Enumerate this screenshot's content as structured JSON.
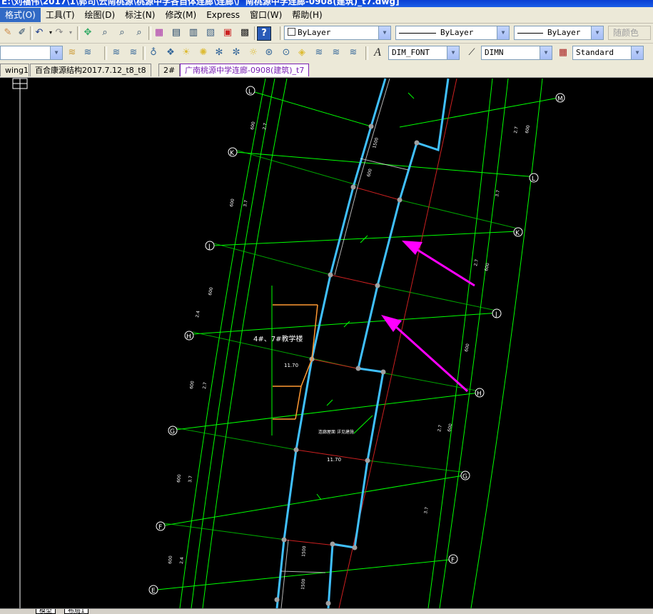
{
  "window": {
    "title": "E:\\刘福伟\\2017\\1\\郭司\\云南桃源\\桃源中学各自体连廊\\连廊\\广南桃源中学连廊-0908(建筑)_t7.dwg]"
  },
  "menu": [
    {
      "label": "格式(O)",
      "active": true
    },
    {
      "label": "工具(T)"
    },
    {
      "label": "绘图(D)"
    },
    {
      "label": "标注(N)"
    },
    {
      "label": "修改(M)"
    },
    {
      "label": "Express"
    },
    {
      "label": "窗口(W)"
    },
    {
      "label": "帮助(H)"
    }
  ],
  "toolbar1": {
    "color_combo": "ByLayer",
    "linetype_combo": "ByLayer",
    "lineweight_combo": "ByLayer",
    "plotstyle": "随颜色"
  },
  "toolbar2": {
    "text_style": "DIM_FONT",
    "dim_style": "DIMN",
    "table_style": "Standard"
  },
  "tabs": [
    {
      "label": "wing1"
    },
    {
      "label": "百合康源结构2017.7.12_t8_t8"
    },
    {
      "label": "2#"
    },
    {
      "label": "广南桃源中学连廊-0908(建筑)_t7",
      "active": true
    }
  ],
  "layout_tabs": [
    "模型",
    "布局1"
  ],
  "drawing": {
    "axis_labels": [
      "M",
      "L",
      "L",
      "K",
      "K",
      "J",
      "J",
      "H",
      "H",
      "G",
      "G",
      "F",
      "F",
      "E"
    ],
    "building_label": "4#、7#教学楼",
    "elevations": [
      "11.70",
      "11.70"
    ],
    "note": "连廊屋面 详见建施",
    "dims": [
      "1500",
      "600",
      "2.7",
      "3.7",
      "600",
      "2.4"
    ],
    "colors": {
      "axis": "#00ff00",
      "wall": "#40c0ff",
      "center_line": "#cc2020",
      "arrow": "#ff00ff",
      "building": "#ff9933",
      "text": "#ffffff"
    }
  }
}
